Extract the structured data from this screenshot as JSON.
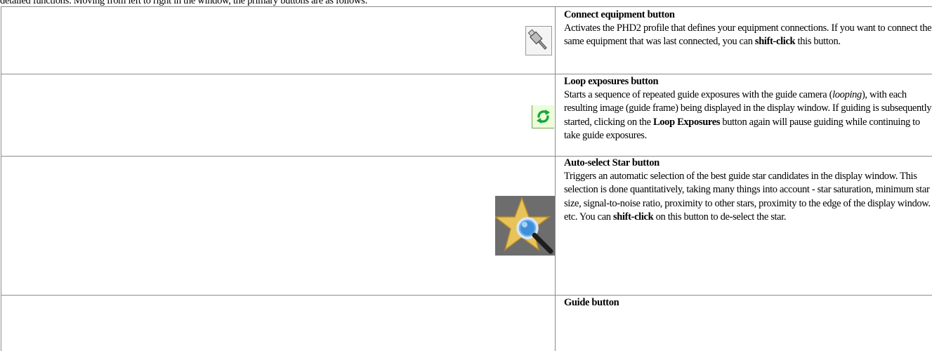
{
  "intro_text": "detailed functions. Moving from left to right in the window, the primary buttons are as follows:",
  "rows": [
    {
      "title": "Connect equipment button",
      "segments": [
        {
          "text": "Activates the PHD2 profile that defines your equipment connections.  If you want to connect the same equipment that was last connected, you can ",
          "style": "normal"
        },
        {
          "text": "shift-click",
          "style": "bold"
        },
        {
          "text": " this button.",
          "style": "normal"
        }
      ],
      "icon": "usb-plug-icon"
    },
    {
      "title": "Loop exposures button",
      "segments": [
        {
          "text": "Starts a sequence of repeated guide exposures with the guide camera (",
          "style": "normal"
        },
        {
          "text": "looping",
          "style": "italic"
        },
        {
          "text": "), with each resulting image (guide frame) being displayed in the display window.  If guiding is subsequently started, clicking on the ",
          "style": "normal"
        },
        {
          "text": "Loop Exposures",
          "style": "bold"
        },
        {
          "text": " button again will pause guiding while continuing to take guide exposures.",
          "style": "normal"
        }
      ],
      "icon": "loop-arrows-icon"
    },
    {
      "title": "Auto-select Star button",
      "segments": [
        {
          "text": "Triggers an automatic selection of the best guide star candidates in the display window. This selection is done quantitatively, taking many things into account - star saturation, minimum star size, signal-to-noise ratio, proximity to other stars, proximity to the edge of the display window. etc.  You can ",
          "style": "normal"
        },
        {
          "text": "shift-click",
          "style": "bold"
        },
        {
          "text": " on this button to de-select the star.",
          "style": "normal"
        }
      ],
      "icon": "star-magnifier-icon"
    },
    {
      "title": "Guide button",
      "segments": [],
      "icon": "guide-icon"
    }
  ],
  "colors": {
    "border": "#8c8c8c",
    "loop_green": "#1aa33c",
    "star_gold": "#e8c35a",
    "star_bg": "#6d6d6d",
    "lens_blue": "#3f8fd8"
  }
}
